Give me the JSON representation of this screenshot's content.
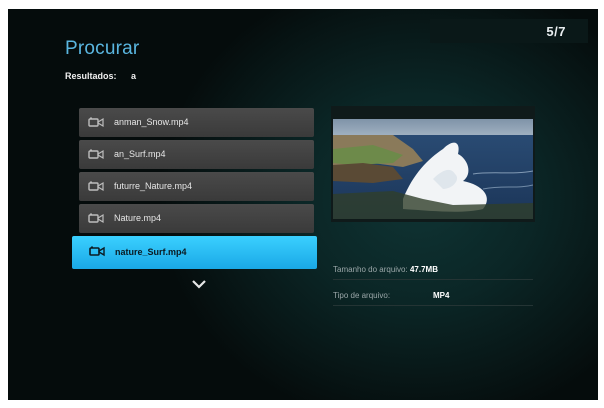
{
  "header": {
    "title": "Procurar",
    "counter": "5/7"
  },
  "search": {
    "label": "Resultados:",
    "query": "a"
  },
  "files": [
    {
      "name": "anman_Snow.mp4",
      "icon": "video-camera-icon",
      "selected": false
    },
    {
      "name": "an_Surf.mp4",
      "icon": "video-camera-icon",
      "selected": false
    },
    {
      "name": "futurre_Nature.mp4",
      "icon": "video-camera-icon",
      "selected": false
    },
    {
      "name": "Nature.mp4",
      "icon": "video-camera-icon",
      "selected": false
    },
    {
      "name": "nature_Surf.mp4",
      "icon": "video-camera-icon",
      "selected": true
    }
  ],
  "more_indicator": "chevron-down-icon",
  "details": {
    "size_label": "Tamanho do arquivo:",
    "size_value": "47.7MB",
    "type_label": "Tipo de arquivo:",
    "type_value": "MP4"
  },
  "colors": {
    "accent": "#5ab6e0",
    "selection": "#2ec0f5",
    "item_bg": "#444444",
    "background": "#0b2626"
  }
}
